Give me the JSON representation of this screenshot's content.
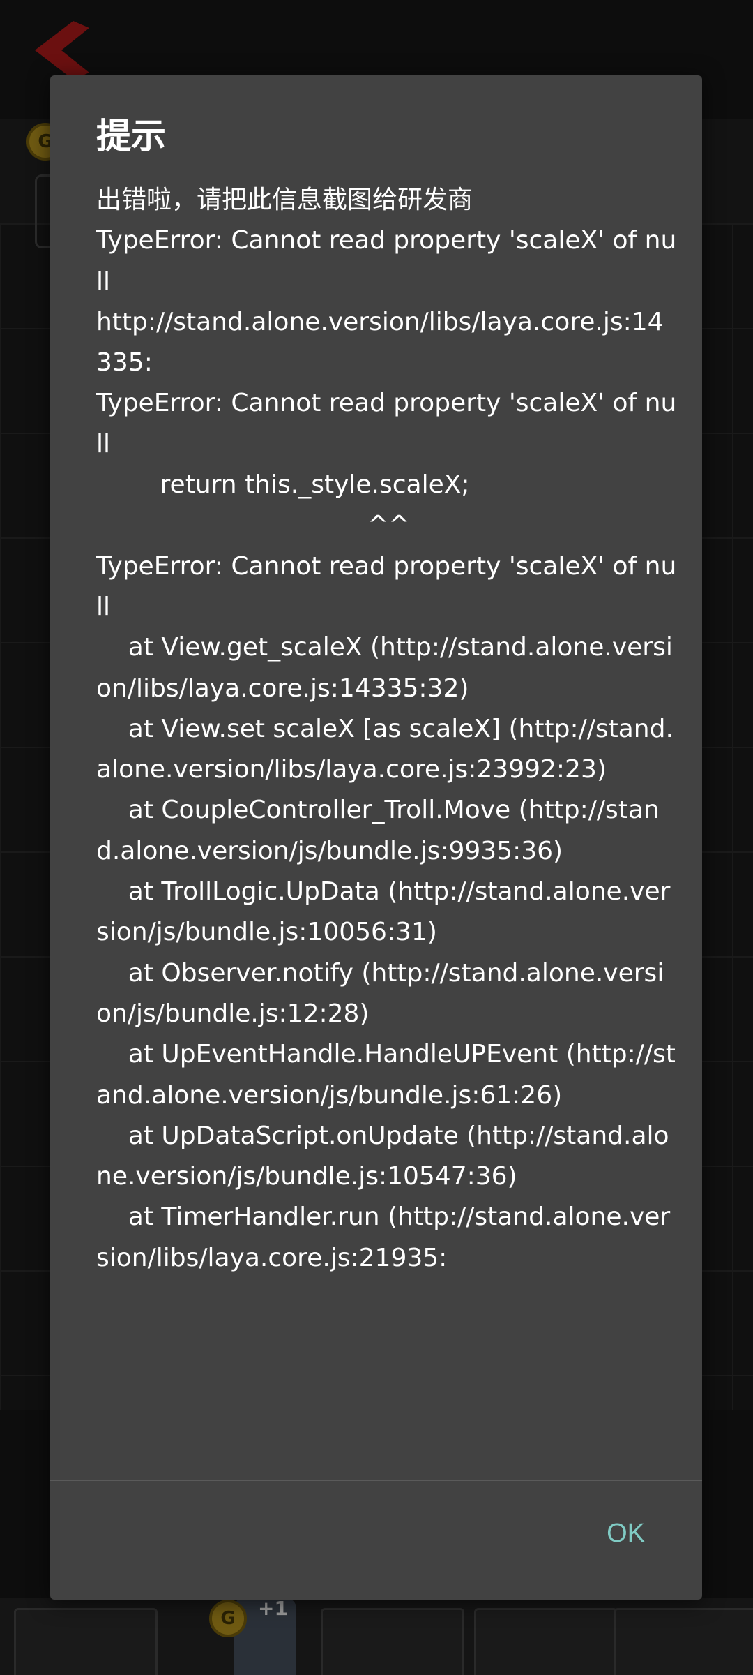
{
  "dialog": {
    "title": "提示",
    "message": "出错啦，请把此信息截图给研发商\nTypeError: Cannot read property 'scaleX' of null\nhttp://stand.alone.version/libs/laya.core.js:14335:\nTypeError: Cannot read property 'scaleX' of null\n        return this._style.scaleX;\n                                  ^^\nTypeError: Cannot read property 'scaleX' of null\n    at View.get_scaleX (http://stand.alone.version/libs/laya.core.js:14335:32)\n    at View.set scaleX [as scaleX] (http://stand.alone.version/libs/laya.core.js:23992:23)\n    at CoupleController_Troll.Move (http://stand.alone.version/js/bundle.js:9935:36)\n    at TrollLogic.UpData (http://stand.alone.version/js/bundle.js:10056:31)\n    at Observer.notify (http://stand.alone.version/js/bundle.js:12:28)\n    at UpEventHandle.HandleUPEvent (http://stand.alone.version/js/bundle.js:61:26)\n    at UpDataScript.onUpdate (http://stand.alone.version/js/bundle.js:10547:36)\n    at TimerHandler.run (http://stand.alone.version/libs/laya.core.js:21935:",
    "ok_label": "OK"
  },
  "background": {
    "coin_symbol": "G",
    "bonus_text": "+1"
  },
  "colors": {
    "dialog_bg": "#424242",
    "accent": "#80cbc4",
    "back_arrow": "#b71c1c"
  }
}
